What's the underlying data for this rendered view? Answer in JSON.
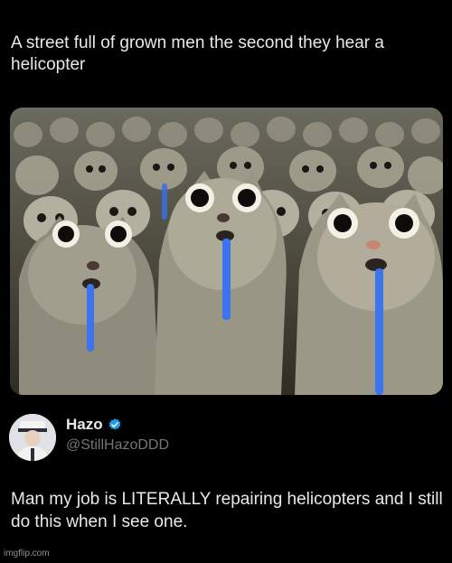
{
  "post": {
    "text": "A street full of grown men the second they hear a helicopter"
  },
  "media": {
    "icon": "crying-cats-crowd-image"
  },
  "reply": {
    "display_name": "Hazo",
    "handle": "@StillHazoDDD",
    "verified_color": "#1d9bf0",
    "text": "Man my job is LITERALLY repairing helicopters and I still do this when I see one."
  },
  "watermark": "imgflip.com"
}
